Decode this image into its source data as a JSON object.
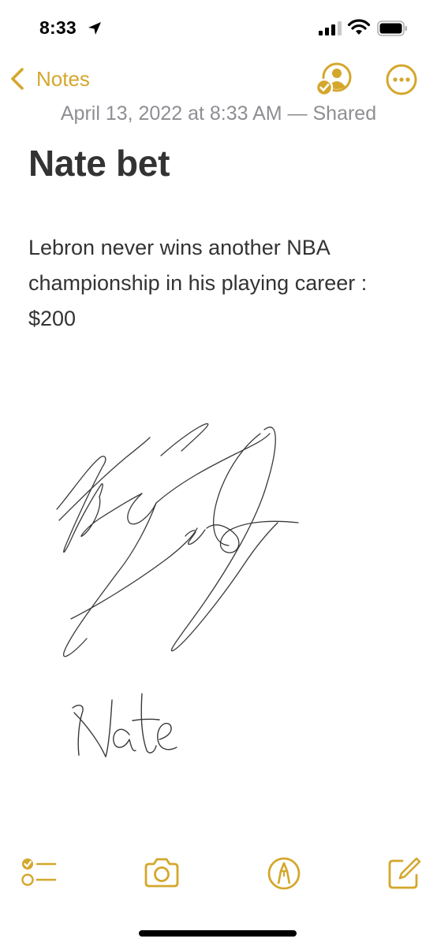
{
  "status_bar": {
    "time": "8:33",
    "icons": [
      "location-arrow-icon",
      "cellular-signal-icon",
      "wifi-icon",
      "battery-icon"
    ]
  },
  "nav": {
    "back_label": "Notes",
    "back_icon": "chevron-left-icon",
    "share_icon": "shared-person-checkmark-icon",
    "more_icon": "ellipsis-circle-icon"
  },
  "note": {
    "date": "April 13, 2022 at 8:33 AM — Shared",
    "title": "Nate bet",
    "body": "Lebron never wins another NBA championship in his playing career : $200",
    "drawing": {
      "type": "handwritten-signatures",
      "text": "Nate"
    }
  },
  "toolbar": {
    "items": [
      "checklist-icon",
      "camera-icon",
      "markup-pen-icon",
      "compose-icon"
    ]
  },
  "colors": {
    "accent": "#d4a72c",
    "title_text": "#333333",
    "meta_text": "#8e8e93",
    "background": "#ffffff"
  }
}
